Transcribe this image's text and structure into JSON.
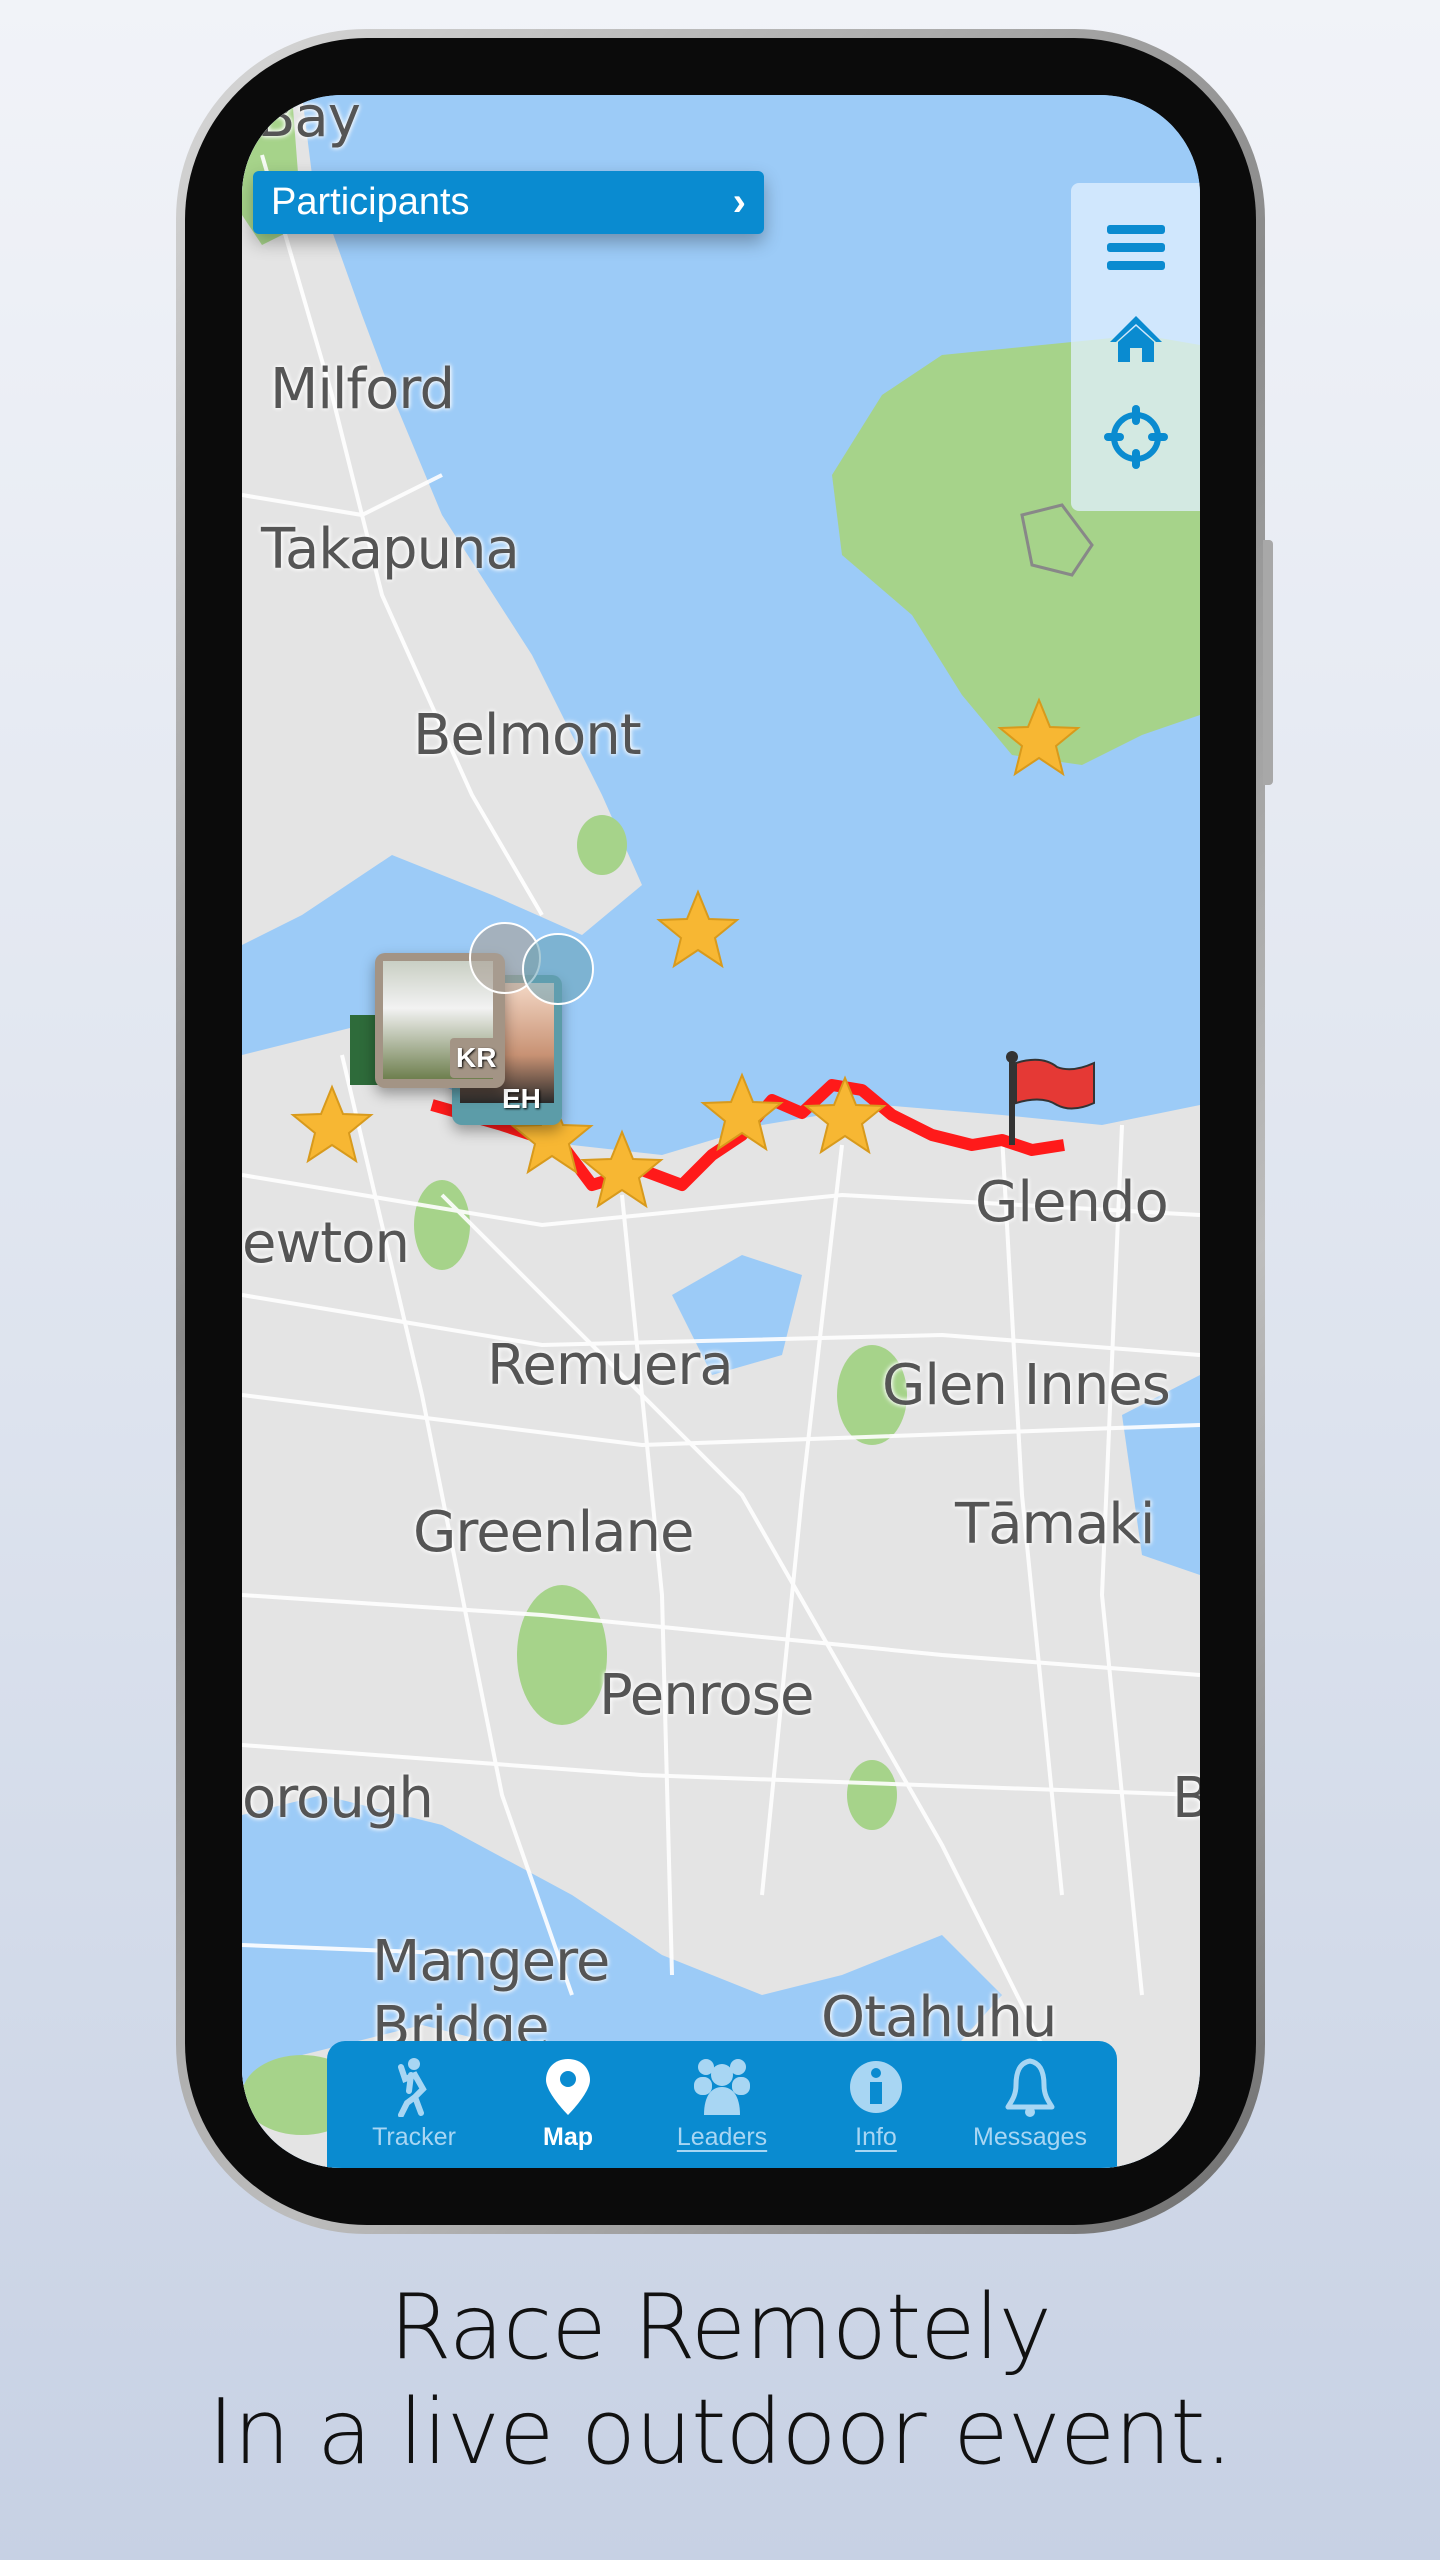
{
  "top_bar": {
    "participants_label": "Participants"
  },
  "side_panel": {
    "icons": [
      "menu-icon",
      "home-icon",
      "crosshair-icon"
    ],
    "color": "#0a8bd0"
  },
  "map": {
    "labels": [
      "Bay",
      "Milford",
      "Takapuna",
      "Belmont",
      "ewton",
      "Remuera",
      "Glen Innes",
      "Greenlane",
      "Tāmaki",
      "Penrose",
      "orough",
      "Mangere",
      "Bridge",
      "Otahuhu",
      "Glendo",
      "B"
    ],
    "participants": [
      {
        "initials": "KR"
      },
      {
        "initials": "EH"
      }
    ],
    "route_color": "#ff1a1a"
  },
  "nav": {
    "items": [
      {
        "label": "Tracker",
        "icon": "runner-icon",
        "active": false
      },
      {
        "label": "Map",
        "icon": "map-pin-icon",
        "active": true
      },
      {
        "label": "Leaders",
        "icon": "group-icon",
        "active": false
      },
      {
        "label": "Info",
        "icon": "info-icon",
        "active": false
      },
      {
        "label": "Messages",
        "icon": "bell-icon",
        "active": false
      }
    ]
  },
  "caption": {
    "line1": "Race Remotely",
    "line2": "In a live outdoor event."
  }
}
